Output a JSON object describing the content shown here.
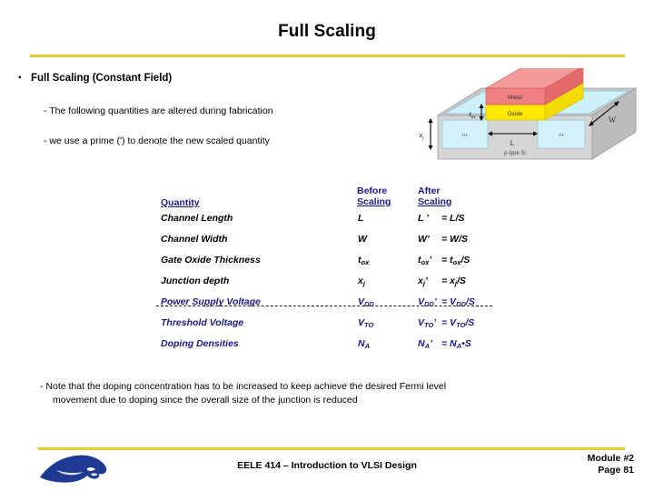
{
  "slide": {
    "title": "Full Scaling",
    "accent_gold": "#e8c832",
    "accent_navy": "#1a1a8c",
    "bullet_marker": "▪",
    "bullet_main": "Full Scaling (Constant Field)",
    "sub_bullets": [
      "- The following quantities are altered during fabrication",
      "- we use a prime (') to denote the new scaled quantity"
    ],
    "note_line1": "- Note that the doping concentration has to be increased to keep achieve the desired Fermi level",
    "note_line2": "movement due to doping since the overall size of the junction is reduced"
  },
  "figure": {
    "name": "mosfet-3d-diagram",
    "labels": {
      "metal": "Metal",
      "oxide": "Oxide",
      "nplus_left": "n+",
      "nplus_right": "n+",
      "substrate": "p-type Si",
      "tox": "t",
      "tox_sub": "ox",
      "width": "W",
      "length": "L",
      "xj": "x",
      "xj_sub": "j"
    },
    "colors": {
      "metal": "#f08080",
      "metal_top": "#f49b9b",
      "oxide": "#ffe800",
      "nplus": "#c8f0f8",
      "substrate": "#d4d4d4",
      "substrate_top": "#c0c0c0"
    }
  },
  "table": {
    "headers": {
      "quantity": "Quantity",
      "before_l1": "Before",
      "before_l2": "Scaling",
      "after_l1": "After",
      "after_l2": "Scaling"
    },
    "rows": [
      {
        "name": "Channel Length",
        "before": "L",
        "before_sub": "",
        "after_lhs": "L ’",
        "after_rhs": "= L/S",
        "color": "black"
      },
      {
        "name": "Channel Width",
        "before": "W",
        "before_sub": "",
        "after_lhs": "W’",
        "after_rhs": "= W/S",
        "color": "black"
      },
      {
        "name": "Gate Oxide Thickness",
        "before": "t",
        "before_sub": "ox",
        "after_lhs": "t",
        "after_lhs_sub": "ox",
        "after_lhs_tail": "’",
        "after_rhs": "= t",
        "after_rhs_sub": "ox",
        "after_rhs_tail": "/S",
        "color": "black"
      },
      {
        "name": "Junction depth",
        "before": "x",
        "before_sub": "j",
        "after_lhs": "x",
        "after_lhs_sub": "j",
        "after_lhs_tail": "’",
        "after_rhs": "= x",
        "after_rhs_sub": "j",
        "after_rhs_tail": "/S",
        "color": "black"
      },
      {
        "name": "Power Supply Voltage",
        "before": "V",
        "before_sub": "DD",
        "after_lhs": "V",
        "after_lhs_sub": "DD",
        "after_lhs_tail": "’",
        "after_rhs": "= V",
        "after_rhs_sub": "DD",
        "after_rhs_tail": "/S",
        "color": "blue"
      },
      {
        "name": "Threshold Voltage",
        "before": "V",
        "before_sub": "TO",
        "after_lhs": "V",
        "after_lhs_sub": "TO",
        "after_lhs_tail": "’",
        "after_rhs": "= V",
        "after_rhs_sub": "TO",
        "after_rhs_tail": "/S",
        "color": "blue"
      },
      {
        "name": "Doping Densities",
        "before": "N",
        "before_sub": "A",
        "after_lhs": "N",
        "after_lhs_sub": "A",
        "after_lhs_tail": "’",
        "after_rhs": "= N",
        "after_rhs_sub": "A",
        "after_rhs_tail": "•S",
        "color": "blue"
      }
    ],
    "separator_after_row_index": 3
  },
  "footer": {
    "course": "EELE 414 – Introduction to VLSI Design",
    "module": "Module #2",
    "page": "Page 81",
    "logo_name": "bobcat-logo",
    "logo_color": "#1f3a93"
  }
}
